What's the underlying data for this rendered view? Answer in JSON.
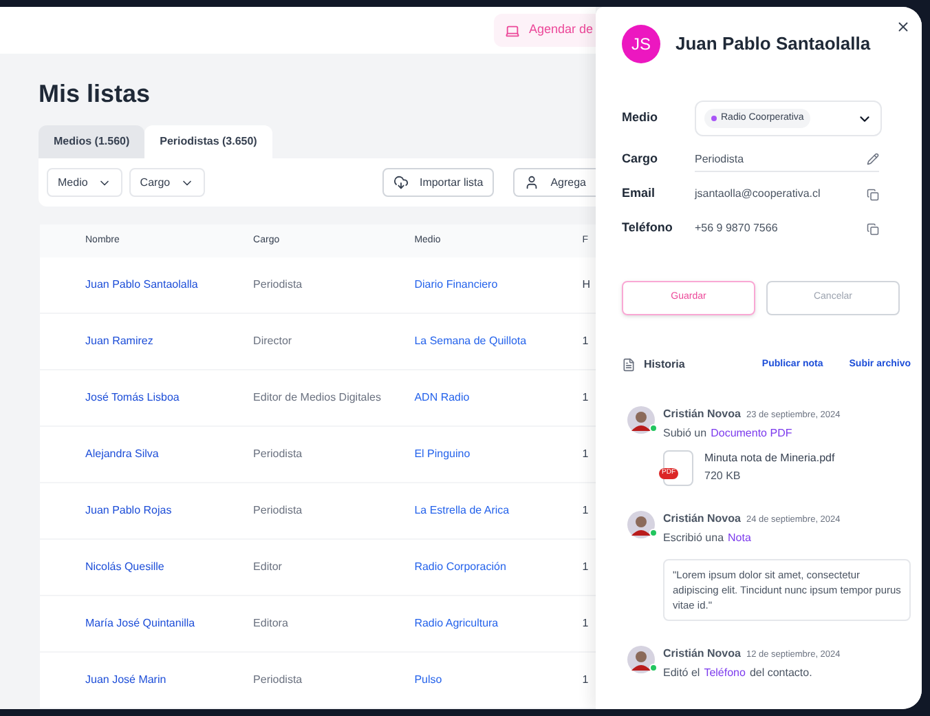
{
  "header": {
    "demo_button": "Agendar de"
  },
  "page_title": "Mis listas",
  "tabs": [
    {
      "label": "Medios (1.560)",
      "selected": false
    },
    {
      "label": "Periodistas (3.650)",
      "selected": true
    }
  ],
  "filters": [
    "Medio",
    "Cargo"
  ],
  "actions": [
    {
      "kind": "import",
      "label": "Importar lista"
    },
    {
      "kind": "add",
      "label": "Agrega"
    }
  ],
  "table": {
    "columns": [
      "Nombre",
      "Cargo",
      "Medio",
      "F"
    ],
    "rows": [
      [
        "Juan Pablo Santaolalla",
        "Periodista",
        "Diario Financiero",
        "H"
      ],
      [
        "Juan Ramirez",
        "Director",
        "La Semana de Quillota",
        "1"
      ],
      [
        "José Tomás Lisboa",
        "Editor de Medios Digitales",
        "ADN Radio",
        "1"
      ],
      [
        "Alejandra Silva",
        "Periodista",
        "El Pinguino",
        "1"
      ],
      [
        "Juan Pablo Rojas",
        "Periodista",
        "La Estrella de Arica",
        "1"
      ],
      [
        "Nicolás Quesille",
        "Editor",
        "Radio Corporación",
        "1"
      ],
      [
        "María José Quintanilla",
        "Editora",
        "Radio Agricultura",
        "1"
      ],
      [
        "Juan José Marin",
        "Periodista",
        "Pulso",
        "1"
      ]
    ]
  },
  "contact": {
    "initials": "JS",
    "name": "Juan Pablo Santaolalla",
    "fields": [
      {
        "kind": "select",
        "label": "Medio",
        "value": "Radio Coorperativa",
        "color": "#a855f7"
      },
      {
        "kind": "edit",
        "label": "Cargo",
        "value": "Periodista"
      },
      {
        "kind": "copy",
        "label": "Email",
        "value": "jsantaolla@cooperativa.cl"
      },
      {
        "kind": "copy",
        "label": "Teléfono",
        "value": "+56 9 9870 7566"
      }
    ],
    "buttons": [
      "Guardar",
      "Cancelar"
    ]
  },
  "history": {
    "title": "Historia",
    "links": [
      "Publicar nota",
      "Subir archivo"
    ],
    "entries": [
      {
        "user": "Cristián Novoa",
        "date": "23 de septiembre, 2024",
        "online": true,
        "action": "Subió un",
        "object": "Documento PDF",
        "kind": "file",
        "file_badge": "PDF",
        "file_name": "Minuta nota de Mineria.pdf",
        "file_size": "720 KB"
      },
      {
        "user": "Cristián Novoa",
        "date": "24 de septiembre, 2024",
        "online": true,
        "action": "Escribió una",
        "object": "Nota",
        "kind": "note",
        "note": "\"Lorem ipsum dolor sit amet, consectetur adipiscing elit. Tincidunt nunc ipsum tempor purus vitae id.\""
      },
      {
        "user": "Cristián Novoa",
        "date": "12 de septiembre, 2024",
        "online": true,
        "action": "Editó el",
        "object": "Teléfono",
        "after": "del contacto.",
        "kind": "plain"
      }
    ]
  }
}
